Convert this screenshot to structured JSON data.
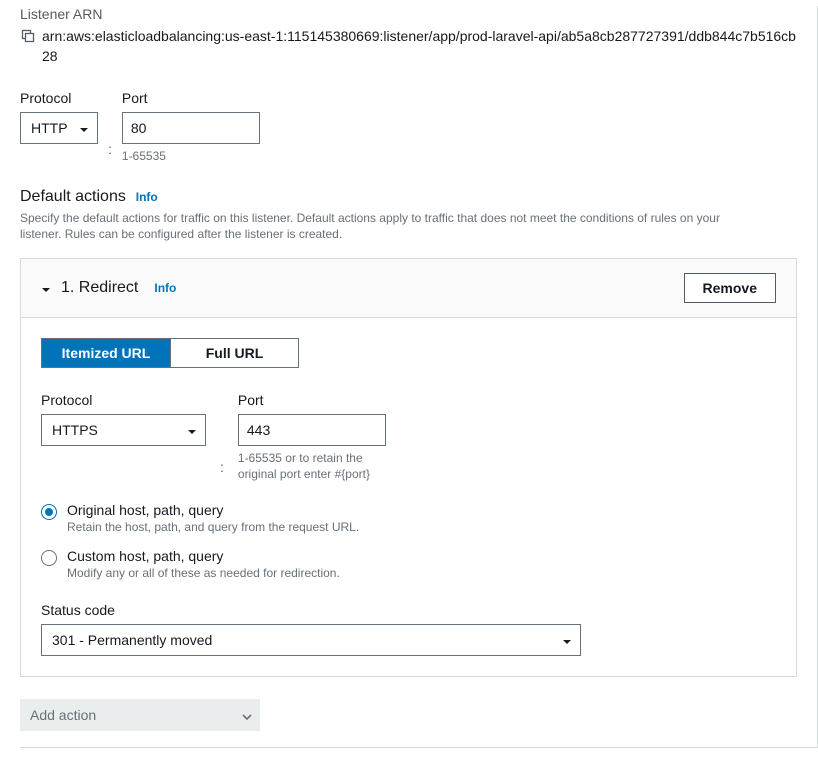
{
  "listener_arn": {
    "label": "Listener ARN",
    "value": "arn:aws:elasticloadbalancing:us-east-1:115145380669:listener/app/prod-laravel-api/ab5a8cb287727391/ddb844c7b516cb28"
  },
  "protocol": {
    "label": "Protocol",
    "value": "HTTP"
  },
  "port": {
    "label": "Port",
    "value": "80",
    "hint": "1-65535"
  },
  "colon": ":",
  "default_actions": {
    "title": "Default actions",
    "info": "Info",
    "desc": "Specify the default actions for traffic on this listener. Default actions apply to traffic that does not meet the conditions of rules on your listener. Rules can be configured after the listener is created."
  },
  "action_card": {
    "title": "1. Redirect",
    "info": "Info",
    "remove": "Remove",
    "tabs": {
      "itemized": "Itemized URL",
      "full": "Full URL"
    },
    "protocol": {
      "label": "Protocol",
      "value": "HTTPS"
    },
    "port": {
      "label": "Port",
      "value": "443",
      "hint": "1-65535 or to retain the original port enter #{port}"
    },
    "colon": ":",
    "radio": {
      "original": {
        "label": "Original host, path, query",
        "desc": "Retain the host, path, and query from the request URL."
      },
      "custom": {
        "label": "Custom host, path, query",
        "desc": "Modify any or all of these as needed for redirection."
      }
    },
    "status": {
      "label": "Status code",
      "value": "301 - Permanently moved"
    }
  },
  "add_action": "Add action"
}
